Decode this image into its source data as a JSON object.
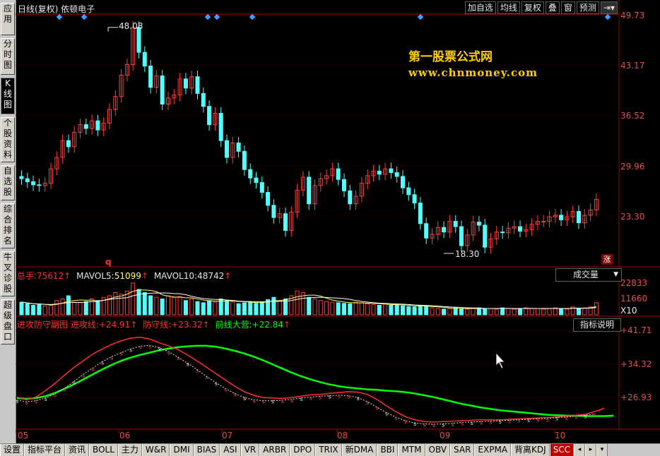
{
  "sidebar": {
    "tabs": [
      {
        "label": "应用",
        "active": false
      },
      {
        "label": "分时图",
        "active": false
      },
      {
        "label": "K线图",
        "active": true
      },
      {
        "label": "个股资料",
        "active": false
      },
      {
        "label": "自选股",
        "active": false
      },
      {
        "label": "综合排名",
        "active": false
      },
      {
        "label": "牛叉诊股",
        "active": false
      },
      {
        "label": "超级盘口",
        "active": false
      }
    ]
  },
  "header": {
    "title": "日线(复权)  依顿电子",
    "buttons": [
      "加自选",
      "均线",
      "复权",
      "叠",
      "窗",
      "预测"
    ],
    "nav_icon": "⇥▾"
  },
  "watermark": {
    "line1": "第一股票公式网",
    "line2": "www.chnmoney.com"
  },
  "price_axis": [
    "49.73",
    "43.17",
    "36.52",
    "29.96",
    "23.30"
  ],
  "annotations": {
    "high": "48.08",
    "low": "18.30",
    "q_marker": "q",
    "zhang": "涨"
  },
  "volume_panel": {
    "total_label": "总手:",
    "total_value": "75612",
    "mavol5_label": "MAVOL5:",
    "mavol5_value": "51099",
    "mavol10_label": "MAVOL10:",
    "mavol10_value": "48742",
    "axis": [
      "22833",
      "11660",
      "X10"
    ],
    "dropdown": "成交量"
  },
  "indicator_panel": {
    "name": "进攻防守副图",
    "attack_label": "进攻线:",
    "attack_value": "+24.91",
    "defend_label": "防守线:",
    "defend_value": "+23.32",
    "front_label": "前线大营:",
    "front_value": "+22.84",
    "button": "指标说明",
    "axis": [
      "+41.71",
      "+34.32",
      "+26.93"
    ]
  },
  "x_axis": [
    "05",
    "06",
    "07",
    "08",
    "09",
    "10"
  ],
  "bottom_tabs": [
    "设置",
    "指标平台",
    "资讯",
    "BOLL",
    "主力",
    "W&R",
    "DMI",
    "BIAS",
    "ASI",
    "VR",
    "ARBR",
    "DPO",
    "TRIX",
    "新DMA",
    "BBI",
    "MTM",
    "OBV",
    "SAR",
    "EXPMA",
    "背离KDJ",
    "SCC"
  ],
  "active_bottom_tab": "SCC",
  "colors": {
    "up": "#ff3c3c",
    "down": "#54ffff",
    "ma_white": "#ffffff",
    "ma_yellow": "#ffff00",
    "front_line": "#00ff00",
    "attack": "#ff3030",
    "defend": "#e0e0e0",
    "axis": "#a00000"
  }
}
